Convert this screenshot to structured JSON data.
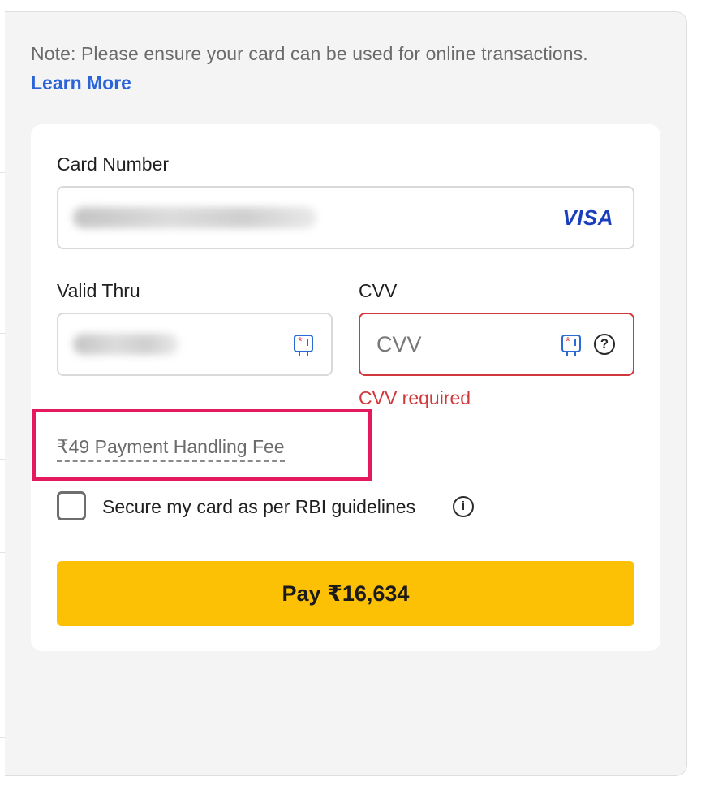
{
  "note": {
    "text": "Note: Please ensure your card can be used for online transactions.",
    "link": "Learn More"
  },
  "card_number": {
    "label": "Card Number",
    "brand": "VISA"
  },
  "valid_thru": {
    "label": "Valid Thru"
  },
  "cvv": {
    "label": "CVV",
    "placeholder": "CVV",
    "help_icon": "?",
    "error": "CVV required"
  },
  "fee": {
    "text": "₹49 Payment Handling Fee"
  },
  "secure_card": {
    "label": "Secure my card as per RBI guidelines",
    "info_icon": "i",
    "checked": false
  },
  "pay_button": {
    "label": "Pay ₹16,634"
  },
  "colors": {
    "accent": "#fcc004",
    "link": "#2a64d8",
    "error": "#d0383c",
    "highlight": "#e5195e"
  },
  "icons": [
    "card-chip-icon",
    "help-icon",
    "info-icon",
    "visa-logo"
  ]
}
